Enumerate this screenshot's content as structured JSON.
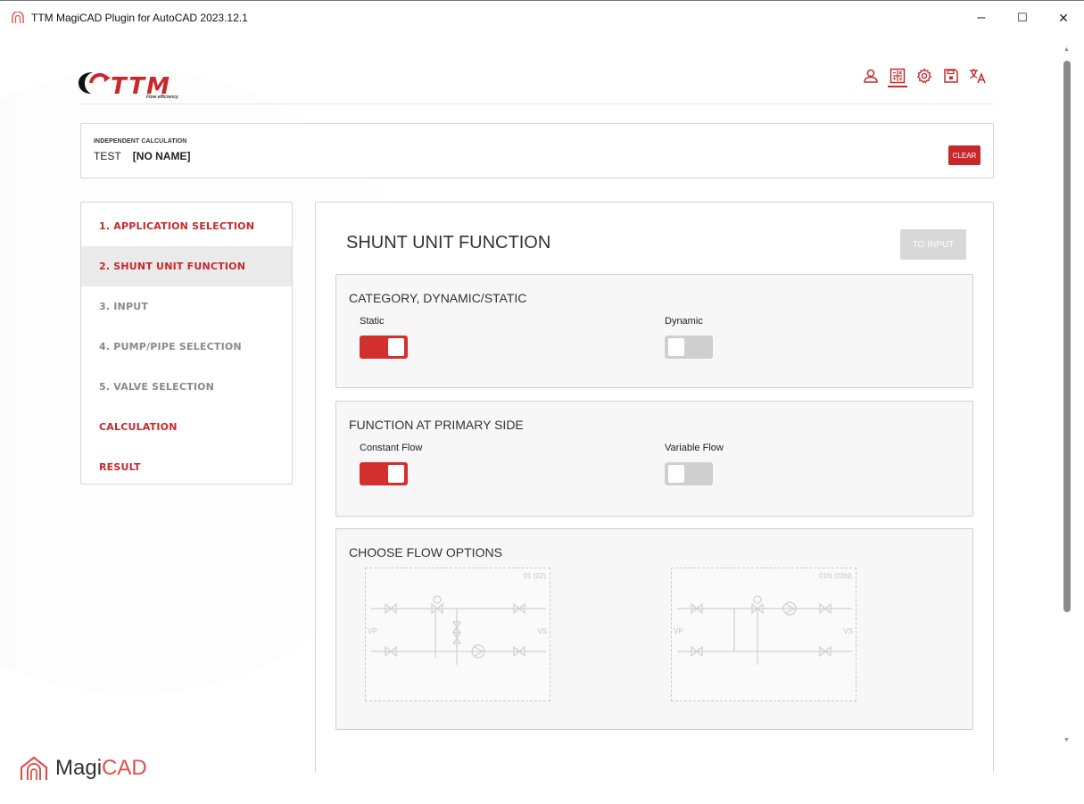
{
  "window": {
    "title": "TTM MagiCAD Plugin for AutoCAD 2023.12.1",
    "minimize": "–",
    "maximize": "☐",
    "close": "✕"
  },
  "header": {
    "logo_text": "TTM",
    "logo_tagline": "Flow efficiency",
    "icons": [
      "user-icon",
      "calculator-icon",
      "gear-icon",
      "save-icon",
      "translate-icon"
    ]
  },
  "project": {
    "label": "INDEPENDENT CALCULATION",
    "name": "TEST",
    "title": "[NO NAME]",
    "clear_label": "CLEAR"
  },
  "nav": {
    "items": [
      {
        "label": "1. APPLICATION SELECTION",
        "state": "enabled"
      },
      {
        "label": "2. SHUNT UNIT FUNCTION",
        "state": "active"
      },
      {
        "label": "3. INPUT",
        "state": "disabled"
      },
      {
        "label": "4. PUMP/PIPE SELECTION",
        "state": "disabled"
      },
      {
        "label": "5. VALVE SELECTION",
        "state": "disabled"
      },
      {
        "label": "CALCULATION",
        "state": "enabled"
      },
      {
        "label": "RESULT",
        "state": "enabled"
      }
    ]
  },
  "main": {
    "title": "SHUNT UNIT FUNCTION",
    "to_input_label": "TO INPUT",
    "sections": {
      "category": {
        "title": "CATEGORY, DYNAMIC/STATIC",
        "left_label": "Static",
        "left_on": true,
        "right_label": "Dynamic",
        "right_on": false
      },
      "primary": {
        "title": "FUNCTION AT PRIMARY SIDE",
        "left_label": "Constant Flow",
        "left_on": true,
        "right_label": "Variable Flow",
        "right_on": false
      },
      "flow": {
        "title": "CHOOSE FLOW OPTIONS",
        "options": [
          {
            "code": "01 (02)",
            "left": "VP",
            "right": "VS"
          },
          {
            "code": "01N (02N)",
            "left": "VP",
            "right": "VS"
          }
        ]
      }
    }
  },
  "footer": {
    "brand_a": "Magi",
    "brand_b": "CAD"
  },
  "colors": {
    "accent": "#c8282c",
    "toggle_on": "#d32f2f",
    "toggle_off": "#cfcfcf",
    "disabled_text": "#8a8a8a"
  }
}
